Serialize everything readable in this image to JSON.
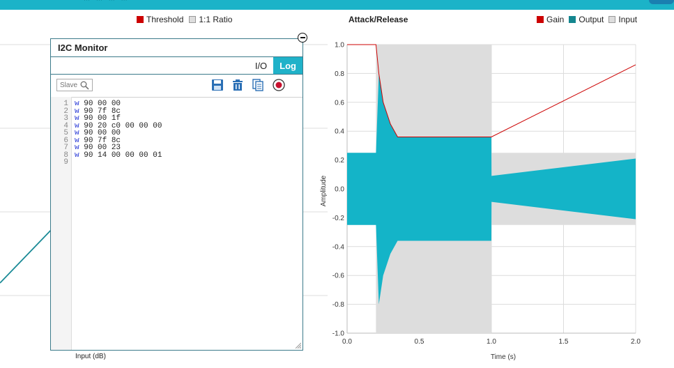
{
  "left_chart": {
    "legend": [
      {
        "label": "Threshold",
        "color": "#cc0000"
      },
      {
        "label": "1:1 Ratio",
        "color": "#dddddd"
      }
    ],
    "xlabel": "Input (dB)",
    "line_color": "#1a8a96"
  },
  "monitor": {
    "title": "I2C Monitor",
    "tabs": [
      {
        "label": "I/O",
        "active": false
      },
      {
        "label": "Log",
        "active": true
      }
    ],
    "slave_placeholder": "Slave",
    "toolbar_icons": [
      "save-icon",
      "trash-icon",
      "copy-icon",
      "record-icon"
    ],
    "log_lines": [
      {
        "num": "1",
        "op": "w",
        "bytes": "90 00 00"
      },
      {
        "num": "2",
        "op": "w",
        "bytes": "90 7f 8c"
      },
      {
        "num": "3",
        "op": "w",
        "bytes": "90 00 1f"
      },
      {
        "num": "4",
        "op": "w",
        "bytes": "90 20 c0 00 00 00"
      },
      {
        "num": "5",
        "op": "w",
        "bytes": "90 00 00"
      },
      {
        "num": "6",
        "op": "w",
        "bytes": "90 7f 8c"
      },
      {
        "num": "7",
        "op": "w",
        "bytes": "90 00 23"
      },
      {
        "num": "8",
        "op": "w",
        "bytes": "90 14 00 00 00 01"
      },
      {
        "num": "9",
        "op": "",
        "bytes": ""
      }
    ]
  },
  "chart_data": {
    "type": "area",
    "title": "Attack/Release",
    "xlabel": "Time (s)",
    "ylabel": "Amplitude",
    "xlim": [
      0,
      2
    ],
    "ylim": [
      -1,
      1
    ],
    "xticks": [
      "0.0",
      "0.5",
      "1.0",
      "1.5",
      "2.0"
    ],
    "yticks": [
      "1.0",
      "0.8",
      "0.6",
      "0.4",
      "0.2",
      "0.0",
      "-0.2",
      "-0.4",
      "-0.6",
      "-0.8",
      "-1.0"
    ],
    "legend_position": "top-right",
    "grid": true,
    "series": [
      {
        "name": "Gain",
        "color": "#cc0000",
        "x": [
          0,
          0.2,
          0.22,
          0.25,
          0.3,
          0.35,
          1.0,
          2.0
        ],
        "y": [
          1.0,
          1.0,
          0.8,
          0.6,
          0.45,
          0.36,
          0.36,
          0.86
        ]
      },
      {
        "name": "Output",
        "color": "#14b4c8",
        "x": [
          0,
          0.2,
          0.22,
          0.25,
          0.3,
          0.35,
          1.0,
          1.001,
          2.0
        ],
        "y": [
          0.25,
          0.25,
          0.8,
          0.6,
          0.45,
          0.36,
          0.36,
          0.09,
          0.21
        ]
      },
      {
        "name": "Input",
        "color": "#dddddd",
        "x": [
          0,
          0.2,
          0.2001,
          1.0,
          1.0001,
          2.0
        ],
        "y": [
          0.25,
          0.25,
          1.0,
          1.0,
          0.25,
          0.25
        ]
      }
    ]
  }
}
